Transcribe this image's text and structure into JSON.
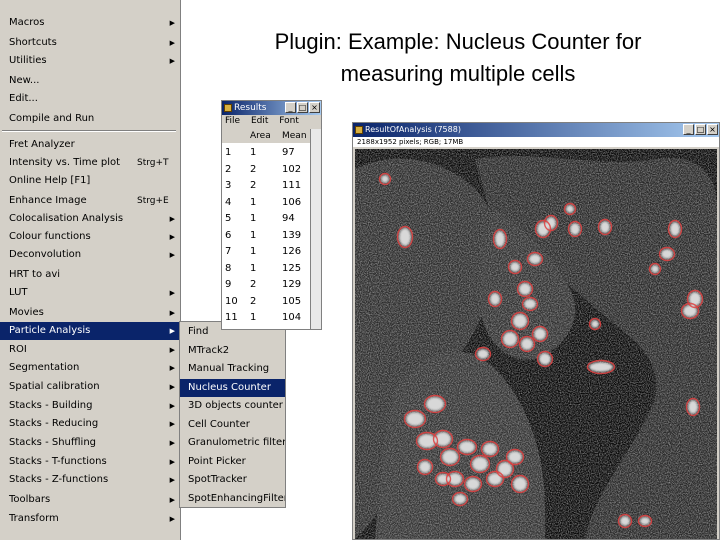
{
  "slide": {
    "title_line1": "Plugin: Example: Nucleus Counter for",
    "title_line2": "measuring multiple cells"
  },
  "plugins_menu": {
    "items": [
      {
        "label": "Macros",
        "arrow": "▶"
      },
      {
        "label": "Shortcuts",
        "arrow": "▶"
      },
      {
        "label": "Utilities",
        "arrow": "▶"
      },
      {
        "label": "New..."
      },
      {
        "label": "Edit..."
      },
      {
        "label": "Compile and Run"
      },
      {
        "label": "Fret Analyzer"
      },
      {
        "label": "Intensity vs. Time plot",
        "shortcut": "Strg+T"
      },
      {
        "label": "Online Help [F1]"
      },
      {
        "label": "Enhance Image",
        "shortcut": "Strg+E"
      },
      {
        "label": "Colocalisation Analysis",
        "arrow": "▶"
      },
      {
        "label": "Colour functions",
        "arrow": "▶"
      },
      {
        "label": "Deconvolution",
        "arrow": "▶"
      },
      {
        "label": "HRT to avi"
      },
      {
        "label": "LUT",
        "arrow": "▶"
      },
      {
        "label": "Movies",
        "arrow": "▶"
      },
      {
        "label": "Particle Analysis",
        "arrow": "▶"
      },
      {
        "label": "ROI",
        "arrow": "▶"
      },
      {
        "label": "Segmentation",
        "arrow": "▶"
      },
      {
        "label": "Spatial calibration",
        "arrow": "▶"
      },
      {
        "label": "Stacks - Building",
        "arrow": "▶"
      },
      {
        "label": "Stacks - Reducing",
        "arrow": "▶"
      },
      {
        "label": "Stacks - Shuffling",
        "arrow": "▶"
      },
      {
        "label": "Stacks - T-functions",
        "arrow": "▶"
      },
      {
        "label": "Stacks - Z-functions",
        "arrow": "▶"
      },
      {
        "label": "Toolbars",
        "arrow": "▶"
      },
      {
        "label": "Transform",
        "arrow": "▶"
      }
    ]
  },
  "particle_submenu": {
    "items": [
      "Find",
      "MTrack2",
      "Manual Tracking",
      "Nucleus Counter",
      "3D objects counter",
      "Cell Counter",
      "Granulometric filter",
      "Point Picker",
      "SpotTracker",
      "SpotEnhancingFilter"
    ]
  },
  "results_window": {
    "title": "Results",
    "menu": [
      "File",
      "Edit",
      "Font"
    ],
    "columns": [
      "",
      "Area",
      "Mean"
    ],
    "rows": [
      [
        "1",
        "1",
        "97"
      ],
      [
        "2",
        "2",
        "102"
      ],
      [
        "3",
        "2",
        "111"
      ],
      [
        "4",
        "1",
        "106"
      ],
      [
        "5",
        "1",
        "94"
      ],
      [
        "6",
        "1",
        "139"
      ],
      [
        "7",
        "1",
        "126"
      ],
      [
        "8",
        "1",
        "125"
      ],
      [
        "9",
        "2",
        "129"
      ],
      [
        "10",
        "2",
        "105"
      ],
      [
        "11",
        "1",
        "104"
      ]
    ]
  },
  "image_window": {
    "title": "ResultOfAnalysis (7588)",
    "info": "2188x1952 pixels; RGB; 17MB"
  },
  "colors": {
    "menu_bg": "#d4d0c8",
    "selection": "#0a246a",
    "nucleus_outline": "#e04040"
  }
}
